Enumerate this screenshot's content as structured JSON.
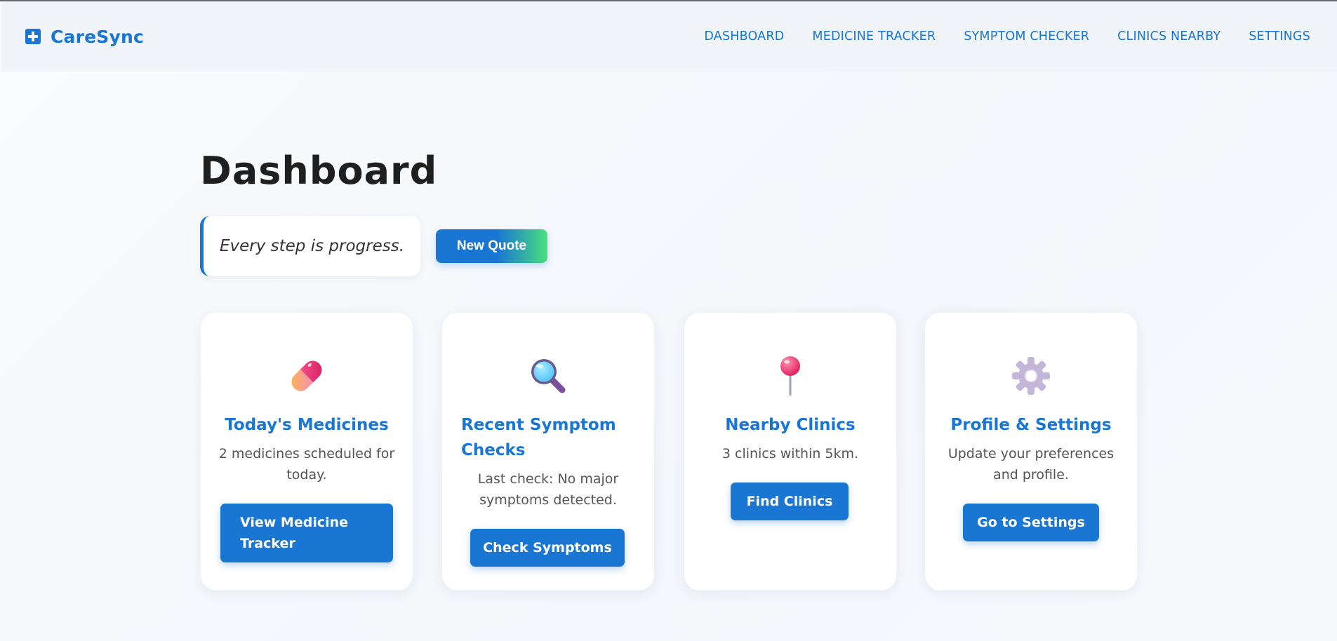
{
  "brand": {
    "name": "CareSync",
    "icon": "medical-cross-icon"
  },
  "nav": {
    "items": [
      {
        "label": "DASHBOARD"
      },
      {
        "label": "MEDICINE TRACKER"
      },
      {
        "label": "SYMPTOM CHECKER"
      },
      {
        "label": "CLINICS NEARBY"
      },
      {
        "label": "SETTINGS"
      }
    ]
  },
  "page": {
    "title": "Dashboard"
  },
  "quote": {
    "text": "Every step is progress.",
    "button_label": "New Quote"
  },
  "cards": [
    {
      "icon": "pill-icon",
      "title": "Today's Medicines",
      "description": "2 medicines scheduled for today.",
      "button_label": "View Medicine Tracker"
    },
    {
      "icon": "magnifying-glass-icon",
      "title": "Recent Symptom Checks",
      "description": "Last check: No major symptoms detected.",
      "button_label": "Check Symptoms"
    },
    {
      "icon": "pushpin-icon",
      "title": "Nearby Clinics",
      "description": "3 clinics within 5km.",
      "button_label": "Find Clinics"
    },
    {
      "icon": "gear-icon",
      "title": "Profile & Settings",
      "description": "Update your preferences and profile.",
      "button_label": "Go to Settings"
    }
  ],
  "colors": {
    "accent": "#1976d2",
    "gradient_end": "#4ade80",
    "background": "#f7fafd"
  }
}
